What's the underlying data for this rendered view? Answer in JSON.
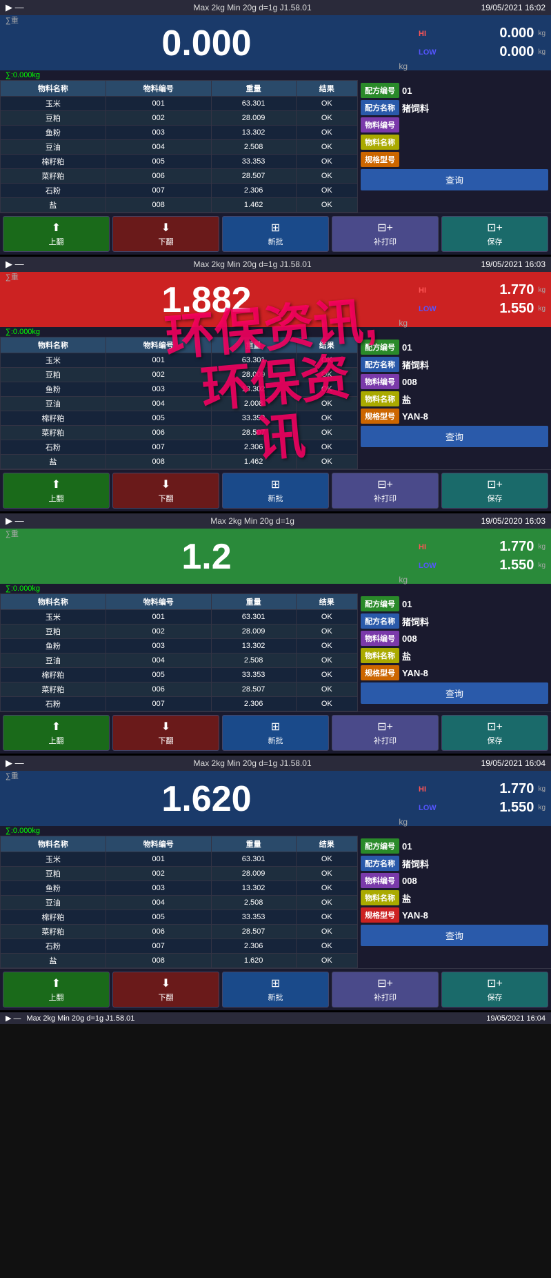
{
  "panels": [
    {
      "id": "panel1",
      "statusBar": {
        "leftIcons": "▶ —",
        "specs": "Max 2kg  Min 20g  d=1g  J1.58.01",
        "datetime": "19/05/2021  16:02"
      },
      "hiLabel": "HI",
      "lowLabel": "LOW",
      "hiValue": "0.000",
      "lowValue": "0.000",
      "mainWeight": "0.000",
      "weightBg": "normal",
      "preset": "∑:0.000kg",
      "unit": "kg",
      "table": {
        "headers": [
          "物料名称",
          "物料编号",
          "重量",
          "结果"
        ],
        "rows": [
          [
            "玉米",
            "001",
            "63.301",
            "OK"
          ],
          [
            "豆粕",
            "002",
            "28.009",
            "OK"
          ],
          [
            "鱼粉",
            "003",
            "13.302",
            "OK"
          ],
          [
            "豆油",
            "004",
            "2.508",
            "OK"
          ],
          [
            "棉籽粕",
            "005",
            "33.353",
            "OK"
          ],
          [
            "菜籽粕",
            "006",
            "28.507",
            "OK"
          ],
          [
            "石粉",
            "007",
            "2.306",
            "OK"
          ],
          [
            "盐",
            "008",
            "1.462",
            "OK"
          ]
        ]
      },
      "rightPanel": {
        "rows": [
          {
            "badgeClass": "badge-green",
            "badgeText": "配方编号",
            "value": "01"
          },
          {
            "badgeClass": "badge-blue",
            "badgeText": "配方名称",
            "value": "猪饲料"
          },
          {
            "badgeClass": "badge-purple",
            "badgeText": "物料编号",
            "value": ""
          },
          {
            "badgeClass": "badge-yellow",
            "badgeText": "物料名称",
            "value": ""
          },
          {
            "badgeClass": "badge-orange",
            "badgeText": "规格型号",
            "value": ""
          }
        ],
        "queryBtn": "查询"
      },
      "toolbar": {
        "buttons": [
          {
            "class": "up",
            "icon": "⬆",
            "label": "上翻"
          },
          {
            "class": "down",
            "icon": "⬇",
            "label": "下翻"
          },
          {
            "class": "new",
            "icon": "⊞",
            "label": "新批"
          },
          {
            "class": "print",
            "icon": "⊟+",
            "label": "补打印"
          },
          {
            "class": "save",
            "icon": "⊡+",
            "label": "保存"
          }
        ]
      },
      "watermark": null
    },
    {
      "id": "panel2",
      "statusBar": {
        "leftIcons": "▶ —",
        "specs": "Max 2kg  Min 20g  d=1g  J1.58.01",
        "datetime": "19/05/2021  16:03"
      },
      "hiLabel": "HI",
      "lowLabel": "LOW",
      "hiValue": "1.770",
      "lowValue": "1.550",
      "mainWeight": "1.882",
      "weightBg": "red",
      "preset": "∑:0.000kg",
      "unit": "kg",
      "table": {
        "headers": [
          "物料名称",
          "物料编号",
          "重量",
          "结果"
        ],
        "rows": [
          [
            "玉米",
            "001",
            "63.301",
            "OK"
          ],
          [
            "豆粕",
            "002",
            "28.009",
            "OK"
          ],
          [
            "鱼粉",
            "003",
            "13.302",
            "OK"
          ],
          [
            "豆油",
            "004",
            "2.008",
            "OK"
          ],
          [
            "棉籽粕",
            "005",
            "33.353",
            "OK"
          ],
          [
            "菜籽粕",
            "006",
            "28.507",
            "OK"
          ],
          [
            "石粉",
            "007",
            "2.306",
            "OK"
          ],
          [
            "盐",
            "008",
            "1.462",
            "OK"
          ]
        ]
      },
      "rightPanel": {
        "rows": [
          {
            "badgeClass": "badge-green",
            "badgeText": "配方编号",
            "value": "01"
          },
          {
            "badgeClass": "badge-blue",
            "badgeText": "配方名称",
            "value": "猪饲料"
          },
          {
            "badgeClass": "badge-purple",
            "badgeText": "物料编号",
            "value": "008"
          },
          {
            "badgeClass": "badge-yellow",
            "badgeText": "物料名称",
            "value": "盐"
          },
          {
            "badgeClass": "badge-orange",
            "badgeText": "规格型号",
            "value": "YAN-8"
          }
        ],
        "queryBtn": "查询"
      },
      "toolbar": {
        "buttons": [
          {
            "class": "up",
            "icon": "⬆",
            "label": "上翻"
          },
          {
            "class": "down",
            "icon": "⬇",
            "label": "下翻"
          },
          {
            "class": "new",
            "icon": "⊞",
            "label": "新批"
          },
          {
            "class": "print",
            "icon": "⊟+",
            "label": "补打印"
          },
          {
            "class": "save",
            "icon": "⊡+",
            "label": "保存"
          }
        ]
      },
      "watermark": "环保资讯,\n环保资\n讯"
    },
    {
      "id": "panel3",
      "statusBar": {
        "leftIcons": "▶ —",
        "specs": "Max 2kg  Min 20g  d=1g",
        "datetime": "19/05/2020  16:03"
      },
      "hiLabel": "HI",
      "lowLabel": "LOW",
      "hiValue": "1.770",
      "lowValue": "1.550",
      "mainWeight": "1.2",
      "weightBg": "green",
      "preset": "∑:0.000kg",
      "unit": "kg",
      "table": {
        "headers": [
          "物料名称",
          "物料编号",
          "重量",
          "结果"
        ],
        "rows": [
          [
            "玉米",
            "001",
            "63.301",
            "OK"
          ],
          [
            "豆粕",
            "002",
            "28.009",
            "OK"
          ],
          [
            "鱼粉",
            "003",
            "13.302",
            "OK"
          ],
          [
            "豆油",
            "004",
            "2.508",
            "OK"
          ],
          [
            "棉籽粕",
            "005",
            "33.353",
            "OK"
          ],
          [
            "菜籽粕",
            "006",
            "28.507",
            "OK"
          ],
          [
            "石粉",
            "007",
            "2.306",
            "OK"
          ]
        ]
      },
      "rightPanel": {
        "rows": [
          {
            "badgeClass": "badge-green",
            "badgeText": "配方编号",
            "value": "01"
          },
          {
            "badgeClass": "badge-blue",
            "badgeText": "配方名称",
            "value": "猪饲料"
          },
          {
            "badgeClass": "badge-purple",
            "badgeText": "物料编号",
            "value": "008"
          },
          {
            "badgeClass": "badge-yellow",
            "badgeText": "物料名称",
            "value": "盐"
          },
          {
            "badgeClass": "badge-orange",
            "badgeText": "规格型号",
            "value": "YAN-8"
          }
        ],
        "queryBtn": "查询"
      },
      "toolbar": {
        "buttons": [
          {
            "class": "up",
            "icon": "⬆",
            "label": "上翻"
          },
          {
            "class": "down",
            "icon": "⬇",
            "label": "下翻"
          },
          {
            "class": "new",
            "icon": "⊞",
            "label": "新批"
          },
          {
            "class": "print",
            "icon": "⊟+",
            "label": "补打印"
          },
          {
            "class": "save",
            "icon": "⊡+",
            "label": "保存"
          }
        ]
      },
      "watermark": null
    },
    {
      "id": "panel4",
      "statusBar": {
        "leftIcons": "▶ —",
        "specs": "Max 2kg  Min 20g  d=1g  J1.58.01",
        "datetime": "19/05/2021  16:04"
      },
      "hiLabel": "HI",
      "lowLabel": "LOW",
      "hiValue": "1.770",
      "lowValue": "1.550",
      "mainWeight": "1.620",
      "weightBg": "normal",
      "preset": "∑:0.000kg",
      "unit": "kg",
      "table": {
        "headers": [
          "物料名称",
          "物料编号",
          "重量",
          "结果"
        ],
        "rows": [
          [
            "玉米",
            "001",
            "63.301",
            "OK"
          ],
          [
            "豆粕",
            "002",
            "28.009",
            "OK"
          ],
          [
            "鱼粉",
            "003",
            "13.302",
            "OK"
          ],
          [
            "豆油",
            "004",
            "2.508",
            "OK"
          ],
          [
            "棉籽粕",
            "005",
            "33.353",
            "OK"
          ],
          [
            "菜籽粕",
            "006",
            "28.507",
            "OK"
          ],
          [
            "石粉",
            "007",
            "2.306",
            "OK"
          ],
          [
            "盐",
            "008",
            "1.620",
            "OK"
          ]
        ]
      },
      "rightPanel": {
        "rows": [
          {
            "badgeClass": "badge-green",
            "badgeText": "配方编号",
            "value": "01"
          },
          {
            "badgeClass": "badge-blue",
            "badgeText": "配方名称",
            "value": "猪饲料"
          },
          {
            "badgeClass": "badge-purple",
            "badgeText": "物料编号",
            "value": "008"
          },
          {
            "badgeClass": "badge-yellow",
            "badgeText": "物料名称",
            "value": "盐"
          },
          {
            "badgeClass": "badge-red",
            "badgeText": "规格型号",
            "value": "YAN-8"
          }
        ],
        "queryBtn": "查询"
      },
      "toolbar": {
        "buttons": [
          {
            "class": "up",
            "icon": "⬆",
            "label": "上翻"
          },
          {
            "class": "down",
            "icon": "⬇",
            "label": "下翻"
          },
          {
            "class": "new",
            "icon": "⊞",
            "label": "新批"
          },
          {
            "class": "print",
            "icon": "⊟+",
            "label": "补打印"
          },
          {
            "class": "save",
            "icon": "⊡+",
            "label": "保存"
          }
        ]
      },
      "watermark": null
    }
  ],
  "bottomBar": {
    "leftIcons": "▶ —",
    "specs": "Max 2kg  Min 20g  d=1g  J1.58.01",
    "datetime": "19/05/2021  16:04"
  }
}
